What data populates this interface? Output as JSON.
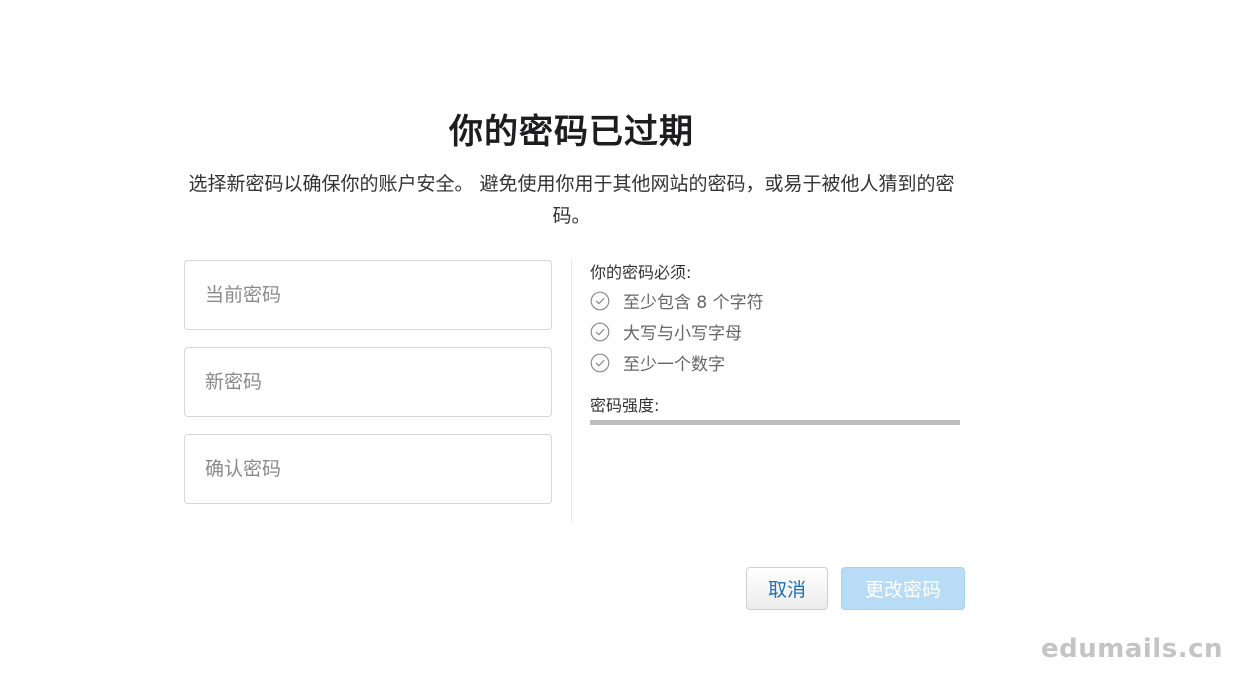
{
  "title": "你的密码已过期",
  "subtitle": "选择新密码以确保你的账户安全。 避免使用你用于其他网站的密码，或易于被他人猜到的密码。",
  "form": {
    "current_password_placeholder": "当前密码",
    "new_password_placeholder": "新密码",
    "confirm_password_placeholder": "确认密码"
  },
  "requirements": {
    "heading": "你的密码必须:",
    "items": [
      {
        "label": "至少包含 8 个字符",
        "icon": "check-circle-icon"
      },
      {
        "label": "大写与小写字母",
        "icon": "check-circle-icon"
      },
      {
        "label": "至少一个数字",
        "icon": "check-circle-icon"
      }
    ],
    "strength_label": "密码强度:",
    "strength_value": 0
  },
  "buttons": {
    "cancel": "取消",
    "change_password": "更改密码"
  },
  "watermark": "edumails.cn",
  "colors": {
    "primary_button_disabled": "#b8dcf5",
    "link_blue": "#1e72b9",
    "strength_track": "#bdbdbd"
  }
}
